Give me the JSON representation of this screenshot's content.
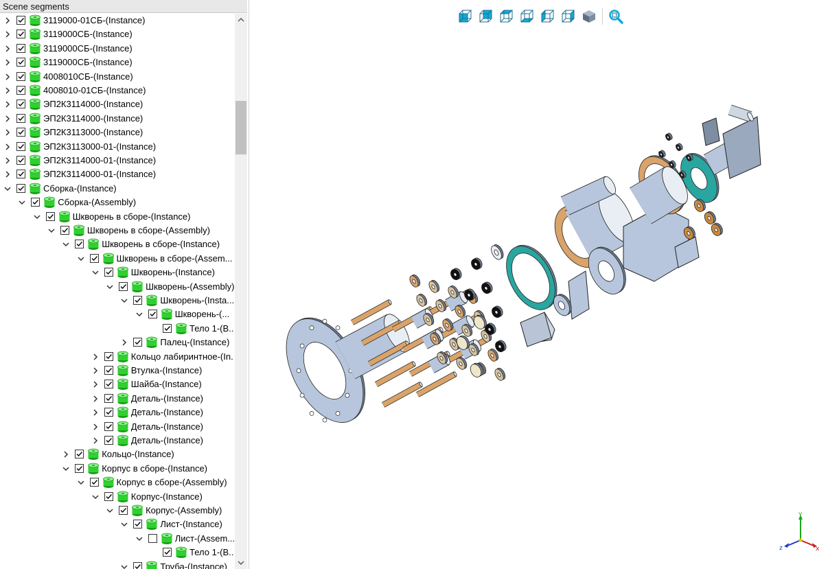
{
  "panel": {
    "title": "Scene segments"
  },
  "tree": [
    {
      "label": "3119000-01СБ-(Instance)",
      "level": 0,
      "expanded": false,
      "checked": true
    },
    {
      "label": "3119000СБ-(Instance)",
      "level": 0,
      "expanded": false,
      "checked": true
    },
    {
      "label": "3119000СБ-(Instance)",
      "level": 0,
      "expanded": false,
      "checked": true
    },
    {
      "label": "3119000СБ-(Instance)",
      "level": 0,
      "expanded": false,
      "checked": true
    },
    {
      "label": "4008010СБ-(Instance)",
      "level": 0,
      "expanded": false,
      "checked": true
    },
    {
      "label": "4008010-01СБ-(Instance)",
      "level": 0,
      "expanded": false,
      "checked": true
    },
    {
      "label": "ЭП2К3114000-(Instance)",
      "level": 0,
      "expanded": false,
      "checked": true
    },
    {
      "label": "ЭП2К3114000-(Instance)",
      "level": 0,
      "expanded": false,
      "checked": true
    },
    {
      "label": "ЭП2К3113000-(Instance)",
      "level": 0,
      "expanded": false,
      "checked": true
    },
    {
      "label": "ЭП2К3113000-01-(Instance)",
      "level": 0,
      "expanded": false,
      "checked": true
    },
    {
      "label": "ЭП2К3114000-01-(Instance)",
      "level": 0,
      "expanded": false,
      "checked": true
    },
    {
      "label": "ЭП2К3114000-01-(Instance)",
      "level": 0,
      "expanded": false,
      "checked": true
    },
    {
      "label": "Сборка-(Instance)",
      "level": 0,
      "expanded": true,
      "checked": true
    },
    {
      "label": "Сборка-(Assembly)",
      "level": 1,
      "expanded": true,
      "checked": true
    },
    {
      "label": "Шкворень в сборе-(Instance)",
      "level": 2,
      "expanded": true,
      "checked": true
    },
    {
      "label": "Шкворень в сборе-(Assembly)",
      "level": 3,
      "expanded": true,
      "checked": true
    },
    {
      "label": "Шкворень в сборе-(Instance)",
      "level": 4,
      "expanded": true,
      "checked": true
    },
    {
      "label": "Шкворень в сборе-(Assem...",
      "level": 5,
      "expanded": true,
      "checked": true
    },
    {
      "label": "Шкворень-(Instance)",
      "level": 6,
      "expanded": true,
      "checked": true
    },
    {
      "label": "Шкворень-(Assembly)",
      "level": 7,
      "expanded": true,
      "checked": true
    },
    {
      "label": "Шкворень-(Insta...",
      "level": 8,
      "expanded": true,
      "checked": true
    },
    {
      "label": "Шкворень-(...",
      "level": 9,
      "expanded": true,
      "checked": true
    },
    {
      "label": "Тело 1-(B...",
      "level": 10,
      "expanded": null,
      "checked": true
    },
    {
      "label": "Палец-(Instance)",
      "level": 8,
      "expanded": false,
      "checked": true
    },
    {
      "label": "Кольцо лабиринтное-(In...",
      "level": 6,
      "expanded": false,
      "checked": true
    },
    {
      "label": "Втулка-(Instance)",
      "level": 6,
      "expanded": false,
      "checked": true
    },
    {
      "label": "Шайба-(Instance)",
      "level": 6,
      "expanded": false,
      "checked": true
    },
    {
      "label": "Деталь-(Instance)",
      "level": 6,
      "expanded": false,
      "checked": true
    },
    {
      "label": "Деталь-(Instance)",
      "level": 6,
      "expanded": false,
      "checked": true
    },
    {
      "label": "Деталь-(Instance)",
      "level": 6,
      "expanded": false,
      "checked": true
    },
    {
      "label": "Деталь-(Instance)",
      "level": 6,
      "expanded": false,
      "checked": true
    },
    {
      "label": "Кольцо-(Instance)",
      "level": 4,
      "expanded": false,
      "checked": true
    },
    {
      "label": "Корпус в сборе-(Instance)",
      "level": 4,
      "expanded": true,
      "checked": true
    },
    {
      "label": "Корпус в сборе-(Assembly)",
      "level": 5,
      "expanded": true,
      "checked": true
    },
    {
      "label": "Корпус-(Instance)",
      "level": 6,
      "expanded": true,
      "checked": true
    },
    {
      "label": "Корпус-(Assembly)",
      "level": 7,
      "expanded": true,
      "checked": true
    },
    {
      "label": "Лист-(Instance)",
      "level": 8,
      "expanded": true,
      "checked": true
    },
    {
      "label": "Лист-(Assem...",
      "level": 9,
      "expanded": true,
      "checked": false
    },
    {
      "label": "Тело 1-(B...",
      "level": 10,
      "expanded": null,
      "checked": true
    },
    {
      "label": "Труба-(Instance)",
      "level": 8,
      "expanded": true,
      "checked": true
    }
  ],
  "toolbar": {
    "views": [
      {
        "name": "view-front-icon"
      },
      {
        "name": "view-back-icon"
      },
      {
        "name": "view-top-icon"
      },
      {
        "name": "view-bottom-icon"
      },
      {
        "name": "view-left-icon"
      },
      {
        "name": "view-right-icon"
      },
      {
        "name": "view-isometric-icon"
      },
      {
        "name": "zoom-fit-icon"
      }
    ]
  },
  "triad": {
    "x": "x",
    "y": "Y",
    "z": "z"
  },
  "colors": {
    "segment_green": "#2fd12f",
    "accent_cyan": "#10a9d8",
    "model_metal": "#b7c6dc",
    "model_bronze": "#d9a36a",
    "model_teal": "#2aa6a0"
  }
}
